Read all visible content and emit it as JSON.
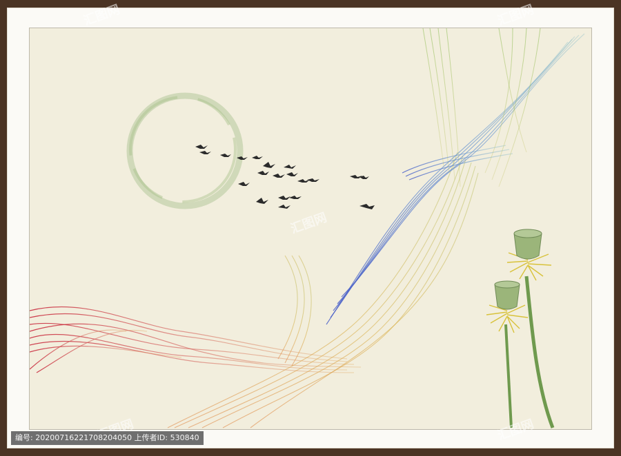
{
  "caption": {
    "text": "编号: 20200716221708204050 上传者ID: 530840"
  },
  "watermark": {
    "text": "汇图网"
  },
  "colors": {
    "frame": "#4b3424",
    "mat": "#fbfaf6",
    "canvas": "#f2eedd",
    "ribbon_red": "#c8283c",
    "ribbon_gold": "#d9a24a",
    "ribbon_blue": "#4a5fc8",
    "ribbon_green": "#8fbf5a",
    "ink_circle": "#a9c28c",
    "lotus_green": "#6f9a4e",
    "stamen_yellow": "#d8c23a"
  }
}
